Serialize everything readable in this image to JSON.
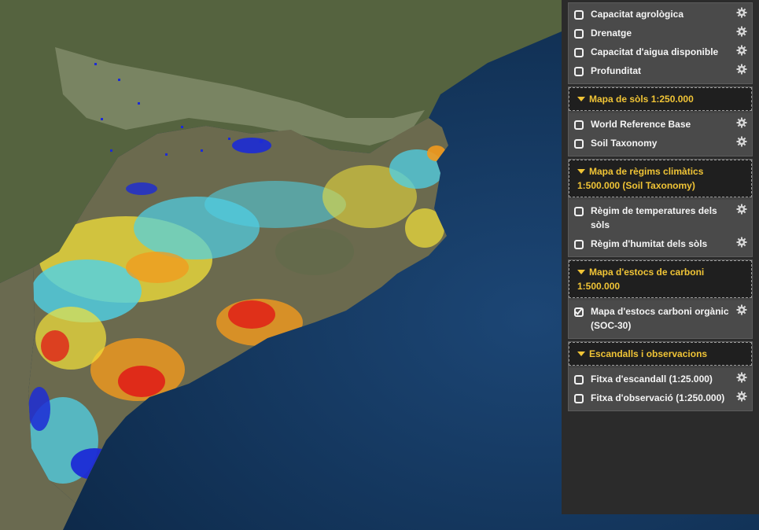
{
  "panel": {
    "groups": [
      {
        "title": "",
        "layers": [
          {
            "label": "Capacitat agrològica",
            "checked": false
          },
          {
            "label": "Drenatge",
            "checked": false
          },
          {
            "label": "Capacitat d'aigua disponible",
            "checked": false
          },
          {
            "label": "Profunditat",
            "checked": false
          }
        ]
      },
      {
        "title": "Mapa de sòls 1:250.000",
        "layers": [
          {
            "label": "World Reference Base",
            "checked": false
          },
          {
            "label": "Soil Taxonomy",
            "checked": false
          }
        ]
      },
      {
        "title": "Mapa de règims climàtics 1:500.000 (Soil Taxonomy)",
        "layers": [
          {
            "label": "Règim de temperatures dels sòls",
            "checked": false
          },
          {
            "label": "Règim d'humitat dels sòls",
            "checked": false
          }
        ]
      },
      {
        "title": "Mapa d'estocs de carboni 1:500.000",
        "layers": [
          {
            "label": "Mapa d'estocs carboni orgànic (SOC-30)",
            "checked": true
          }
        ]
      },
      {
        "title": "Escandalls i observacions",
        "layers": [
          {
            "label": "Fitxa d'escandall (1:25.000)",
            "checked": false
          },
          {
            "label": "Fitxa d'observació (1:250.000)",
            "checked": false
          }
        ]
      }
    ]
  },
  "map": {
    "colors": {
      "sea": "#123456",
      "land": "#5f6b4a",
      "mountains": "#7e8a6d",
      "low": "#1c2bd6",
      "cyan": "#4fd2e8",
      "yellow": "#f3e23a",
      "orange": "#f29a1e",
      "red": "#e02018"
    }
  }
}
